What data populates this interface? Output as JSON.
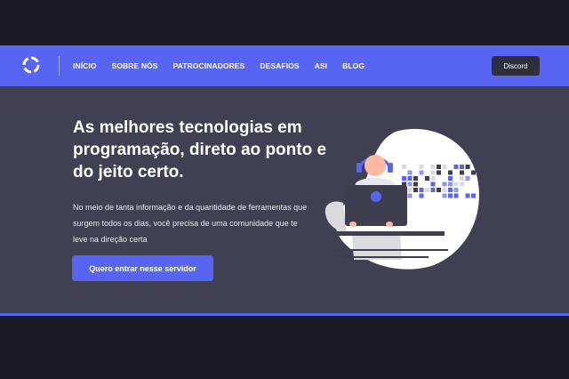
{
  "navbar": {
    "logo_icon": "ring-logo-icon",
    "links": [
      "INÍCIO",
      "SOBRE NÓS",
      "PATROCINADORES",
      "DESAFIOS",
      "ASI",
      "BLOG"
    ],
    "discord_label": "Discord"
  },
  "hero": {
    "title": "As melhores tecnologias em programação, direto ao ponto e do jeito certo.",
    "description": "No meio de tanta informação e da quantidade de ferramentas que surgem todos os dias, você precisa de uma comunidade que te leve na direção certa",
    "cta_label": "Quero entrar nesse servidor",
    "illustration_icon": "person-at-laptop-illustration"
  },
  "colors": {
    "accent": "#5865f2",
    "hero_background": "#414052",
    "page_background": "#1b1a24",
    "button_dark": "#2f2e3d"
  }
}
